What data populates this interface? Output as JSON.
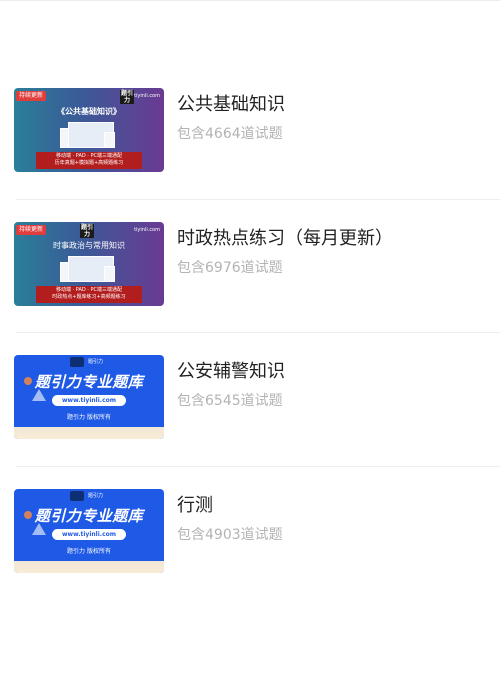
{
  "list": {
    "items": [
      {
        "title": "公共基础知识",
        "count_text": "包含4664道试题",
        "thumb": {
          "style": "A",
          "tag": "持续更新",
          "logo": "题引力",
          "site": "tiyinli.com",
          "headline": "《公共基础知识》",
          "band_line1": "移动端 · PAD · PC端三端通配",
          "band_line2": "历年真题+模拟题+高频题练习"
        }
      },
      {
        "title": "时政热点练习（每月更新）",
        "count_text": "包含6976道试题",
        "thumb": {
          "style": "A",
          "tag": "持续更新",
          "logo": "题引力",
          "site": "tiyinli.com",
          "headline": "时事政治与常用知识",
          "band_line1": "移动端 · PAD · PC端三端通配",
          "band_line2": "时政热点+题库练习+高频题练习"
        }
      },
      {
        "title": "公安辅警知识",
        "count_text": "包含6545道试题",
        "thumb": {
          "style": "B",
          "brand": "题引力",
          "headline": "题引力专业题库",
          "url": "www.tiyinli.com",
          "caption": "题引力 版权所有"
        }
      },
      {
        "title": "行测",
        "count_text": "包含4903道试题",
        "thumb": {
          "style": "B",
          "brand": "题引力",
          "headline": "题引力专业题库",
          "url": "www.tiyinli.com",
          "caption": "题引力 版权所有"
        }
      }
    ]
  }
}
